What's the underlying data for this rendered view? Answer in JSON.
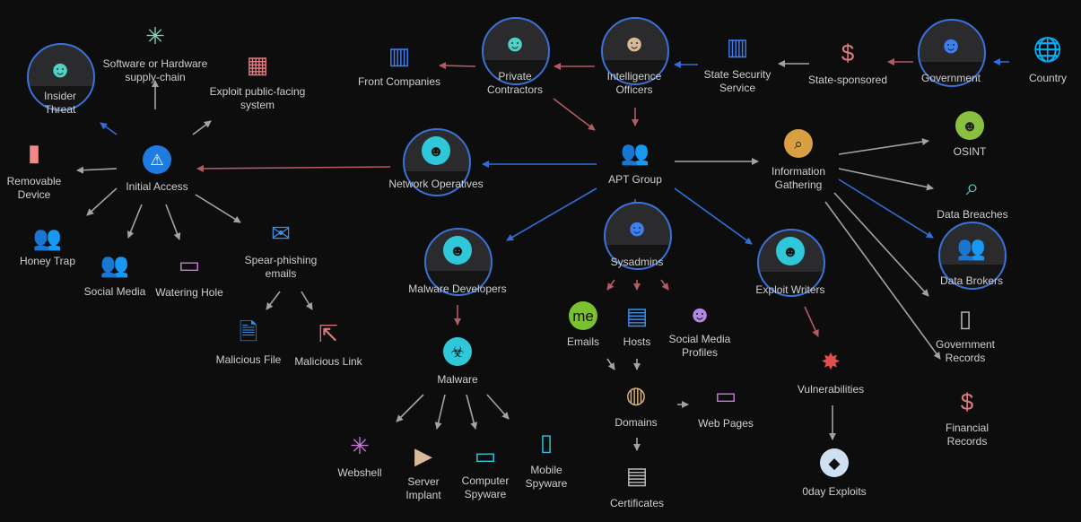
{
  "diagram": {
    "colors": {
      "background": "#0d0d0e",
      "edge_red": "#b35a62",
      "edge_blue": "#2f6fd6",
      "edge_gray": "#a3a3a3",
      "ring": "#3a72d8"
    },
    "nodes": {
      "insider": {
        "label": "Insider\nThreat",
        "icon": "anonymous-mask-icon"
      },
      "supply": {
        "label": "Software or Hardware\nsupply-chain",
        "icon": "network-hub-icon"
      },
      "exploitpub": {
        "label": "Exploit public-facing\nsystem",
        "icon": "circuit-icon"
      },
      "removable": {
        "label": "Removable\nDevice",
        "icon": "usb-remote-icon"
      },
      "initial": {
        "label": "Initial Access",
        "icon": "warning-icon"
      },
      "honey": {
        "label": "Honey Trap",
        "icon": "people-chat-icon"
      },
      "socialmedia": {
        "label": "Social Media",
        "icon": "group-icon"
      },
      "watering": {
        "label": "Watering Hole",
        "icon": "www-monitor-icon"
      },
      "spear": {
        "label": "Spear-phishing\nemails",
        "icon": "envelope-icon"
      },
      "malfile": {
        "label": "Malicious File",
        "icon": "file-globe-icon"
      },
      "mallink": {
        "label": "Malicious Link",
        "icon": "link-cursor-icon"
      },
      "front": {
        "label": "Front Companies",
        "icon": "building-icon"
      },
      "private": {
        "label": "Private\nContractors",
        "icon": "spy-hat-icon"
      },
      "intel": {
        "label": "Intelligence\nOfficers",
        "icon": "officer-icon"
      },
      "statesec": {
        "label": "State Security\nService",
        "icon": "building-icon"
      },
      "statesp": {
        "label": "State-sponsored",
        "icon": "money-stack-icon"
      },
      "government": {
        "label": "Government",
        "icon": "podium-speaker-icon"
      },
      "country": {
        "label": "Country",
        "icon": "globe-icon"
      },
      "netops": {
        "label": "Network Operatives",
        "icon": "hacker-icon"
      },
      "apt": {
        "label": "APT Group",
        "icon": "group-icon"
      },
      "infogath": {
        "label": "Information\nGathering",
        "icon": "magnifier-icon"
      },
      "osint": {
        "label": "OSINT",
        "icon": "spy-icon"
      },
      "breaches": {
        "label": "Data Breaches",
        "icon": "id-search-icon"
      },
      "brokers": {
        "label": "Data Brokers",
        "icon": "group-icon"
      },
      "govrec": {
        "label": "Government\nRecords",
        "icon": "passport-icon"
      },
      "finrec": {
        "label": "Financial\nRecords",
        "icon": "money-stack-icon"
      },
      "sysadmins": {
        "label": "Sysadmins",
        "icon": "user-icon"
      },
      "maldev": {
        "label": "Malware Developers",
        "icon": "hacker-icon"
      },
      "exploitw": {
        "label": "Exploit Writers",
        "icon": "hacker-icon"
      },
      "emails": {
        "label": "Emails",
        "icon": "me-at-icon"
      },
      "hosts": {
        "label": "Hosts",
        "icon": "network-card-icon"
      },
      "smprofiles": {
        "label": "Social Media\nProfiles",
        "icon": "user-icon"
      },
      "malware": {
        "label": "Malware",
        "icon": "biohazard-icon"
      },
      "domains": {
        "label": "Domains",
        "icon": "globe-network-icon"
      },
      "webpages": {
        "label": "Web Pages",
        "icon": "www-monitor-icon"
      },
      "certs": {
        "label": "Certificates",
        "icon": "certificate-icon"
      },
      "vulns": {
        "label": "Vulnerabilities",
        "icon": "bug-icon"
      },
      "zeroday": {
        "label": "0day Exploits",
        "icon": "boot-icon"
      },
      "webshell": {
        "label": "Webshell",
        "icon": "molecule-icon"
      },
      "server": {
        "label": "Server\nImplant",
        "icon": "terminal-icon"
      },
      "compspy": {
        "label": "Computer\nSpyware",
        "icon": "laptop-icon"
      },
      "mobspy": {
        "label": "Mobile\nSpyware",
        "icon": "phone-icon"
      }
    }
  }
}
